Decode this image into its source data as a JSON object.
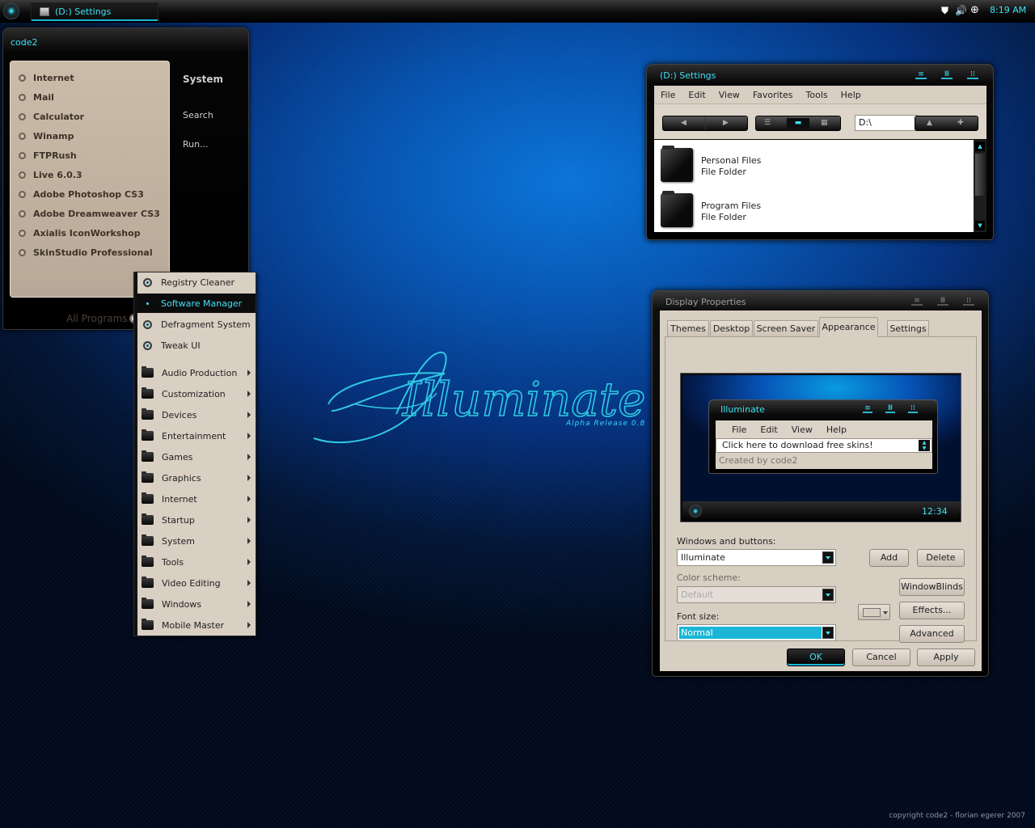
{
  "taskbar": {
    "start_icon": "illuminate-orb-icon",
    "task_label": "(D:) Settings",
    "tray_icons": [
      "shield-icon",
      "speaker-icon",
      "plus-circle-icon"
    ],
    "clock": "8:19 AM"
  },
  "start_menu": {
    "user": "code2",
    "items": [
      "Internet",
      "Mail",
      "Calculator",
      "Winamp",
      "FTPRush",
      "Live 6.0.3",
      "Adobe Photoshop CS3",
      "Adobe Dreamweaver CS3",
      "Axialis IconWorkshop",
      "SkinStudio Professional"
    ],
    "all_programs": "All Programs",
    "right": {
      "system": "System",
      "search": "Search",
      "run": "Run..."
    }
  },
  "programs_menu": {
    "apps": [
      "Registry Cleaner",
      "Software Manager",
      "Defragment System",
      "Tweak UI"
    ],
    "highlighted": "Software Manager",
    "folders": [
      "Audio Production",
      "Customization",
      "Devices",
      "Entertainment",
      "Games",
      "Graphics",
      "Internet",
      "Startup",
      "System",
      "Tools",
      "Video Editing",
      "Windows",
      "Mobile Master"
    ]
  },
  "logo": {
    "title": "Illuminate",
    "subtitle": "Alpha Release 0.8"
  },
  "copyright": "copyright code2 - florian egerer 2007",
  "explorer": {
    "title": "(D:) Settings",
    "menu": [
      "File",
      "Edit",
      "View",
      "Favorites",
      "Tools",
      "Help"
    ],
    "address": "D:\\",
    "files": [
      {
        "name": "Personal Files",
        "type": "File Folder"
      },
      {
        "name": "Program Files",
        "type": "File Folder"
      }
    ]
  },
  "display": {
    "title": "Display Properties",
    "tabs": [
      "Themes",
      "Desktop",
      "Screen Saver",
      "Appearance",
      "Settings"
    ],
    "active_tab": "Appearance",
    "preview": {
      "window_title": "Illuminate",
      "menu": [
        "File",
        "Edit",
        "View",
        "Help"
      ],
      "combo": "Click here to download free skins!",
      "created": "Created by code2",
      "clock": "12:34"
    },
    "windows_buttons_label": "Windows and buttons:",
    "windows_buttons_value": "Illuminate",
    "color_scheme_label": "Color scheme:",
    "color_scheme_value": "Default",
    "font_size_label": "Font size:",
    "font_size_value": "Normal",
    "buttons": {
      "add": "Add",
      "delete": "Delete",
      "windowblinds": "WindowBlinds",
      "effects": "Effects...",
      "advanced": "Advanced",
      "ok": "OK",
      "cancel": "Cancel",
      "apply": "Apply"
    }
  },
  "colors": {
    "accent": "#3fe0f4",
    "menu_bg": "#d8cfc3",
    "start_left_bg": "#cbbcaa"
  }
}
